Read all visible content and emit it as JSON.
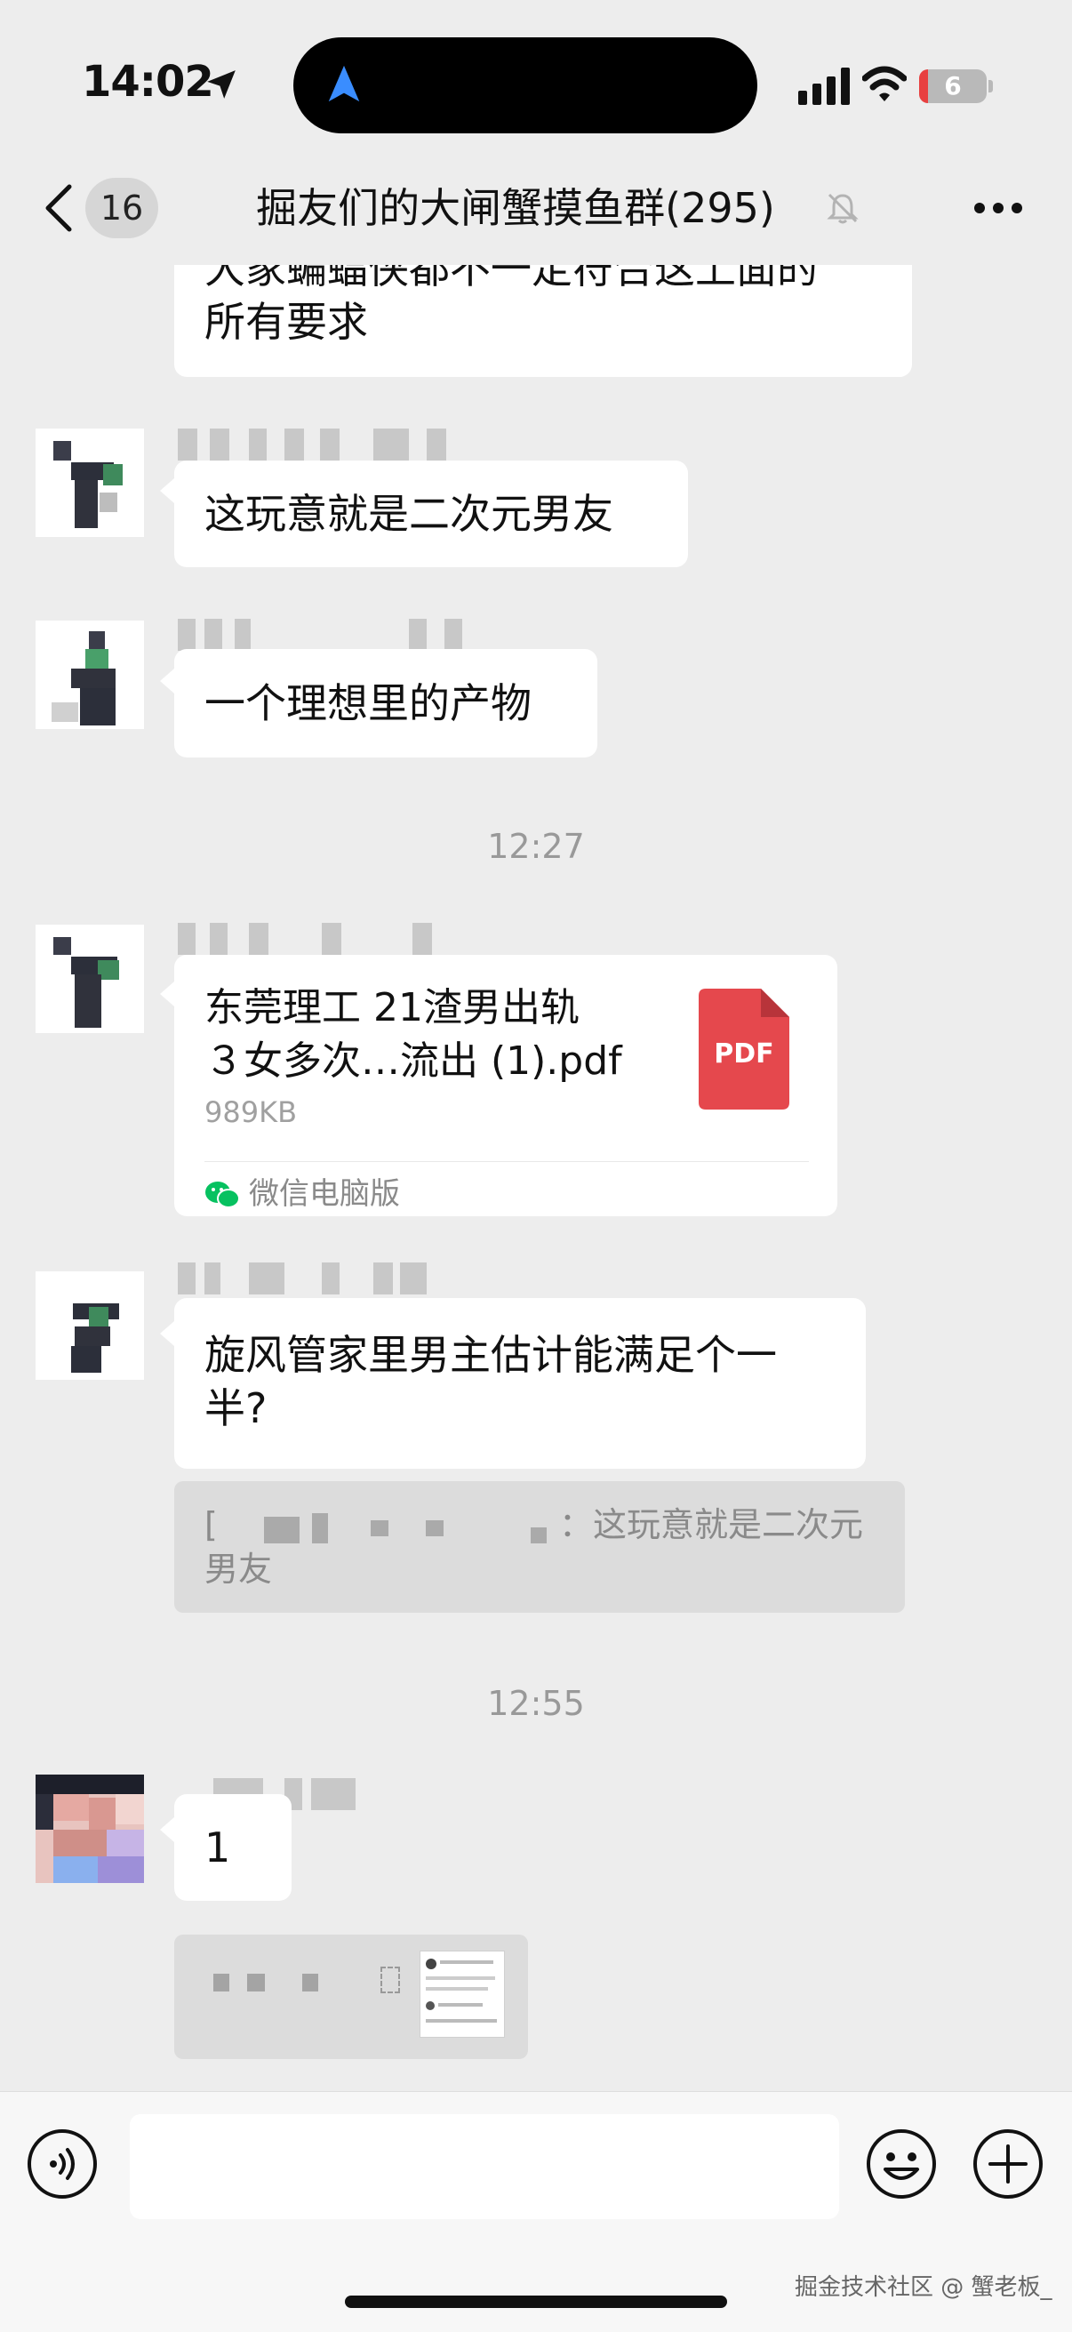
{
  "status_bar": {
    "time": "14:02",
    "battery_level": "6"
  },
  "nav": {
    "back_count": "16",
    "title": "掘友们的大闸蟹摸鱼群(295)"
  },
  "messages": [
    {
      "type": "text",
      "text_line1": "大家蝙蝠侠都不一定符合这上面的",
      "text_line2": "所有要求"
    },
    {
      "type": "text",
      "text": "这玩意就是二次元男友"
    },
    {
      "type": "text",
      "text": "一个理想里的产物"
    },
    {
      "type": "time",
      "text": "12:27"
    },
    {
      "type": "file",
      "name_line1": "东莞理工 21渣男出轨",
      "name_line2": "３女多次…流出 (1).pdf",
      "size": "989KB",
      "badge": "PDF",
      "source": "微信电脑版"
    },
    {
      "type": "text",
      "text_line1": "旋风管家里男主估计能满足个一",
      "text_line2": "半?"
    },
    {
      "type": "quote",
      "prefix": "[",
      "text_tail": "：这玩意就是二次元",
      "text_line2": "男友"
    },
    {
      "type": "time",
      "text": "12:55"
    },
    {
      "type": "text",
      "text": "1"
    }
  ],
  "colors": {
    "background": "#ededed",
    "bubble": "#ffffff",
    "pdf_red": "#e5484d",
    "wechat_green": "#07c160"
  },
  "watermark": "掘金技术社区 @ 蟹老板_"
}
